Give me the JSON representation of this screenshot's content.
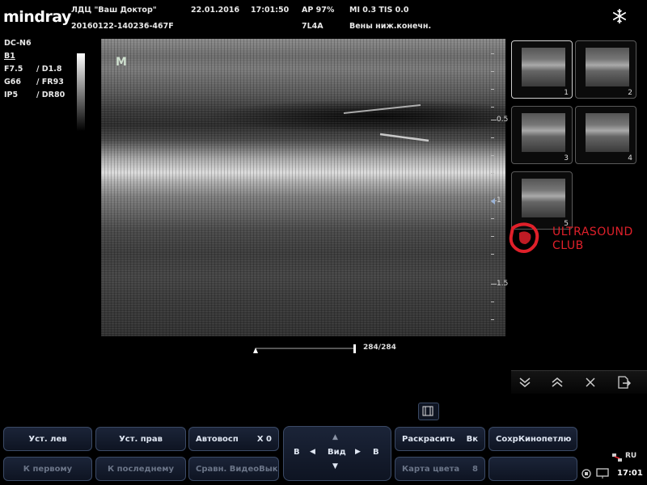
{
  "brand": "mindray",
  "header": {
    "clinic": "ЛДЦ \"Ваш Доктор\"",
    "study_id": "20160122-140236-467F",
    "date": "22.01.2016",
    "time": "17:01:50",
    "ap": "AP  97%",
    "mi_tis": "MI 0.3  TIS 0.0",
    "probe": "7L4A",
    "preset": "Вены ниж.конечн."
  },
  "params": {
    "model": "DC-N6",
    "mode": "B1",
    "rows": [
      {
        "a": "F7.5",
        "b": "/ D1.8"
      },
      {
        "a": "G66",
        "b": "/ FR93"
      },
      {
        "a": "IP5",
        "b": "/ DR80"
      }
    ]
  },
  "image": {
    "marker": "M",
    "depth_labels": [
      "0.5",
      "1",
      "1.5"
    ],
    "cine_counter": "284/284"
  },
  "thumbnails": [
    {
      "n": "1",
      "selected": true
    },
    {
      "n": "2",
      "selected": false
    },
    {
      "n": "3",
      "selected": false
    },
    {
      "n": "4",
      "selected": false
    },
    {
      "n": "5",
      "selected": false
    }
  ],
  "watermark": {
    "line1": "ULTRASOUND",
    "line2": "CLUB"
  },
  "toolbar_icons": [
    "chevrons-down-icon",
    "chevrons-up-icon",
    "close-icon",
    "export-icon"
  ],
  "buttons": {
    "set_left": "Уст. лев",
    "set_right": "Уст. прав",
    "autoplay": "Автовосп",
    "autoplay_value": "X 0",
    "view_b_left": "B",
    "view_label": "Вид",
    "view_b_right": "B",
    "colorize": "Раскрасить",
    "colorize_value": "Вк",
    "save_cine": "СохрКинопетлю",
    "to_first": "К первому",
    "to_last": "К последнему",
    "compare_video": "Сравн. Видео",
    "compare_value": "Вык",
    "color_map": "Карта цвета",
    "color_map_value": "8"
  },
  "status": {
    "lang": "RU",
    "clock": "17:01"
  },
  "colors": {
    "accent_red": "#e0202a",
    "button_border": "#3b4a66"
  }
}
